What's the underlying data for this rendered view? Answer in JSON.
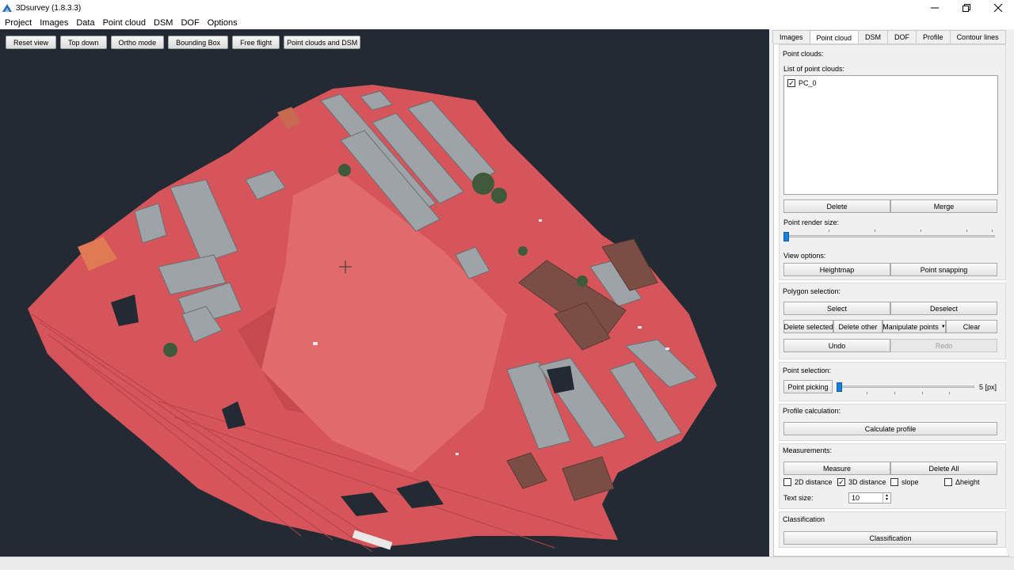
{
  "window": {
    "title": "3Dsurvey (1.8.3.3)"
  },
  "menu": [
    "Project",
    "Images",
    "Data",
    "Point cloud",
    "DSM",
    "DOF",
    "Options"
  ],
  "toolbar": {
    "reset_view": "Reset view",
    "top_down": "Top down",
    "ortho_mode": "Ortho mode",
    "bounding_box": "Bounding Box",
    "free_flight": "Free flight",
    "point_clouds_dsm": "Point clouds and DSM"
  },
  "tabs": [
    "Images",
    "Point cloud",
    "DSM",
    "DOF",
    "Profile",
    "Contour lines"
  ],
  "active_tab": "Point cloud",
  "point_clouds": {
    "title": "Point clouds:",
    "list_label": "List of point clouds:",
    "items": [
      {
        "name": "PC_0",
        "checked": true
      }
    ],
    "delete": "Delete",
    "merge": "Merge",
    "render_size_label": "Point render size:",
    "render_size_level": 0,
    "view_options_label": "View options:",
    "heightmap": "Heightmap",
    "point_snapping": "Point snapping"
  },
  "polygon_selection": {
    "title": "Polygon selection:",
    "select": "Select",
    "deselect": "Deselect",
    "delete_selected": "Delete selected",
    "delete_other": "Delete other",
    "manipulate_points": "Manipulate points",
    "clear": "Clear",
    "undo": "Undo",
    "redo": "Redo"
  },
  "point_selection": {
    "title": "Point selection:",
    "point_picking": "Point picking",
    "value": "5 [px]",
    "level": 0
  },
  "profile_calculation": {
    "title": "Profile calculation:",
    "calculate_profile": "Calculate profile"
  },
  "measurements": {
    "title": "Measurements:",
    "measure": "Measure",
    "delete_all": "Delete All",
    "checks": [
      {
        "label": "2D distance",
        "checked": false
      },
      {
        "label": "3D distance",
        "checked": true
      },
      {
        "label": "slope",
        "checked": false
      },
      {
        "label": "Δheight",
        "checked": false
      }
    ],
    "text_size_label": "Text size:",
    "text_size_value": "10"
  },
  "classification": {
    "title": "Classification",
    "button": "Classification"
  },
  "colors": {
    "viewport_bg": "#232a33",
    "cloud_red": "#d9585c",
    "slider_blue": "#1a7fd8"
  }
}
